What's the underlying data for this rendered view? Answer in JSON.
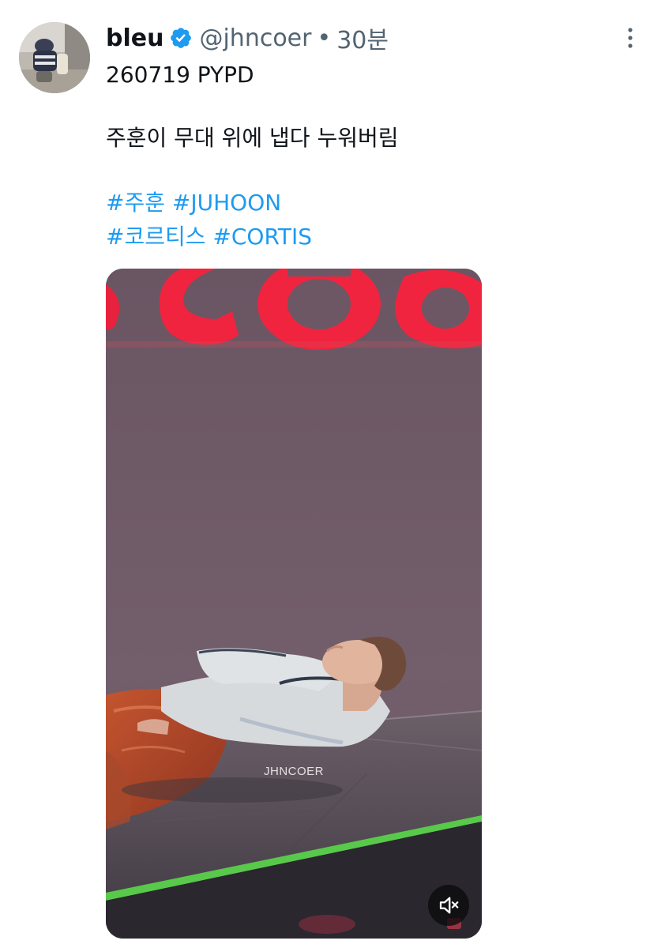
{
  "tweet": {
    "author": {
      "display_name": "bleu",
      "verified": true,
      "handle": "@jhncoer",
      "separator": "•",
      "timestamp": "30분"
    },
    "text_line_1": "260719 PYPD",
    "text_line_2": "주훈이 무대 위에 냅다 누워버림",
    "hashtags": [
      "#주훈",
      "#JUHOON",
      "#코르티스",
      "#CORTIS"
    ],
    "media": {
      "type": "video",
      "watermark": "JHNCOER",
      "muted": true
    }
  },
  "colors": {
    "text": "#0f1419",
    "secondary": "#536471",
    "accent": "#1d9bf0"
  },
  "icons": {
    "verified": "verified-badge-icon",
    "more": "more-vertical-icon",
    "mute": "speaker-muted-icon"
  }
}
